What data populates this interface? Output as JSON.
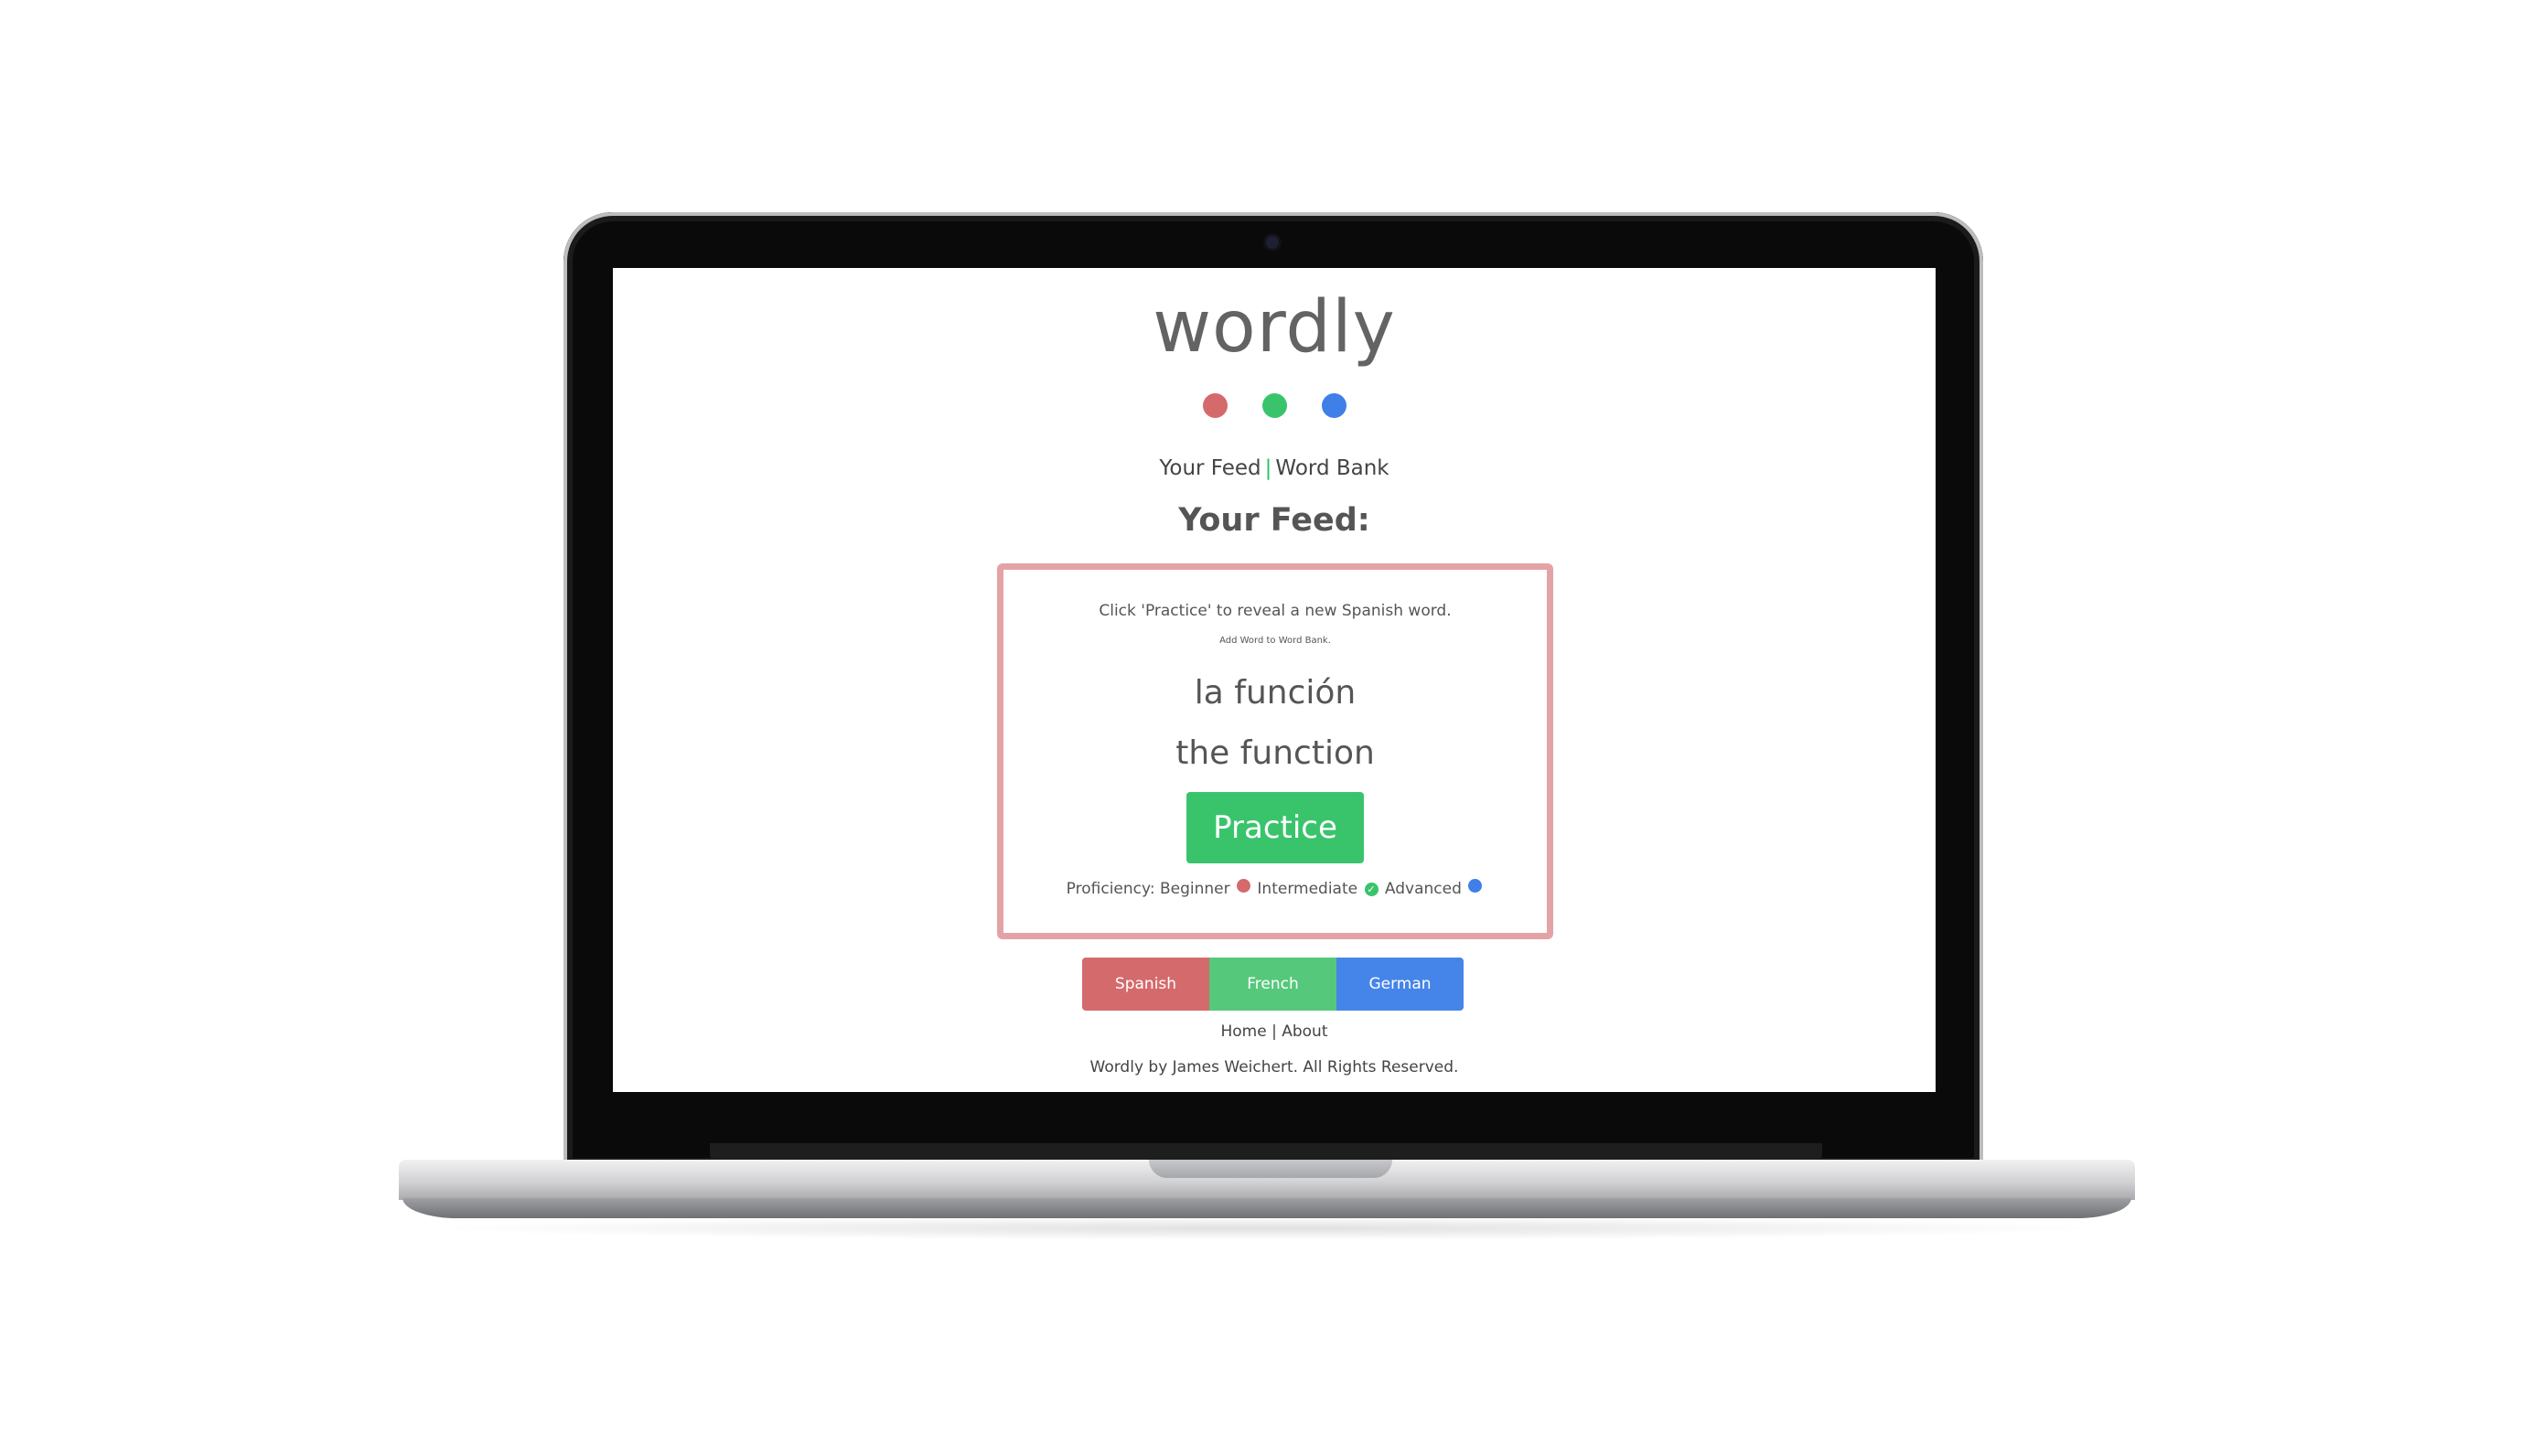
{
  "app": {
    "logo": "wordly",
    "colors": {
      "red": "#d46a6c",
      "green": "#39c46c",
      "blue": "#3f7fe8",
      "card_border": "#e3a3a6"
    }
  },
  "nav": {
    "feed": "Your Feed",
    "separator": "|",
    "word_bank": "Word Bank"
  },
  "feed": {
    "title": "Your Feed:",
    "instruction": "Click 'Practice' to reveal a new Spanish word.",
    "add_word": "Add Word to Word Bank.",
    "word": "la función",
    "translation": "the function",
    "practice_label": "Practice",
    "proficiency": {
      "label": "Proficiency:",
      "beginner": "Beginner",
      "intermediate": "Intermediate",
      "advanced": "Advanced",
      "selected": "intermediate",
      "check_icon": "check-icon"
    }
  },
  "languages": [
    {
      "label": "Spanish",
      "color": "#d46a6c"
    },
    {
      "label": "French",
      "color": "#55c87b"
    },
    {
      "label": "German",
      "color": "#4585ea"
    }
  ],
  "footer": {
    "home": "Home",
    "separator": "|",
    "about": "About",
    "copyright": "Wordly by James Weichert. All Rights Reserved."
  }
}
